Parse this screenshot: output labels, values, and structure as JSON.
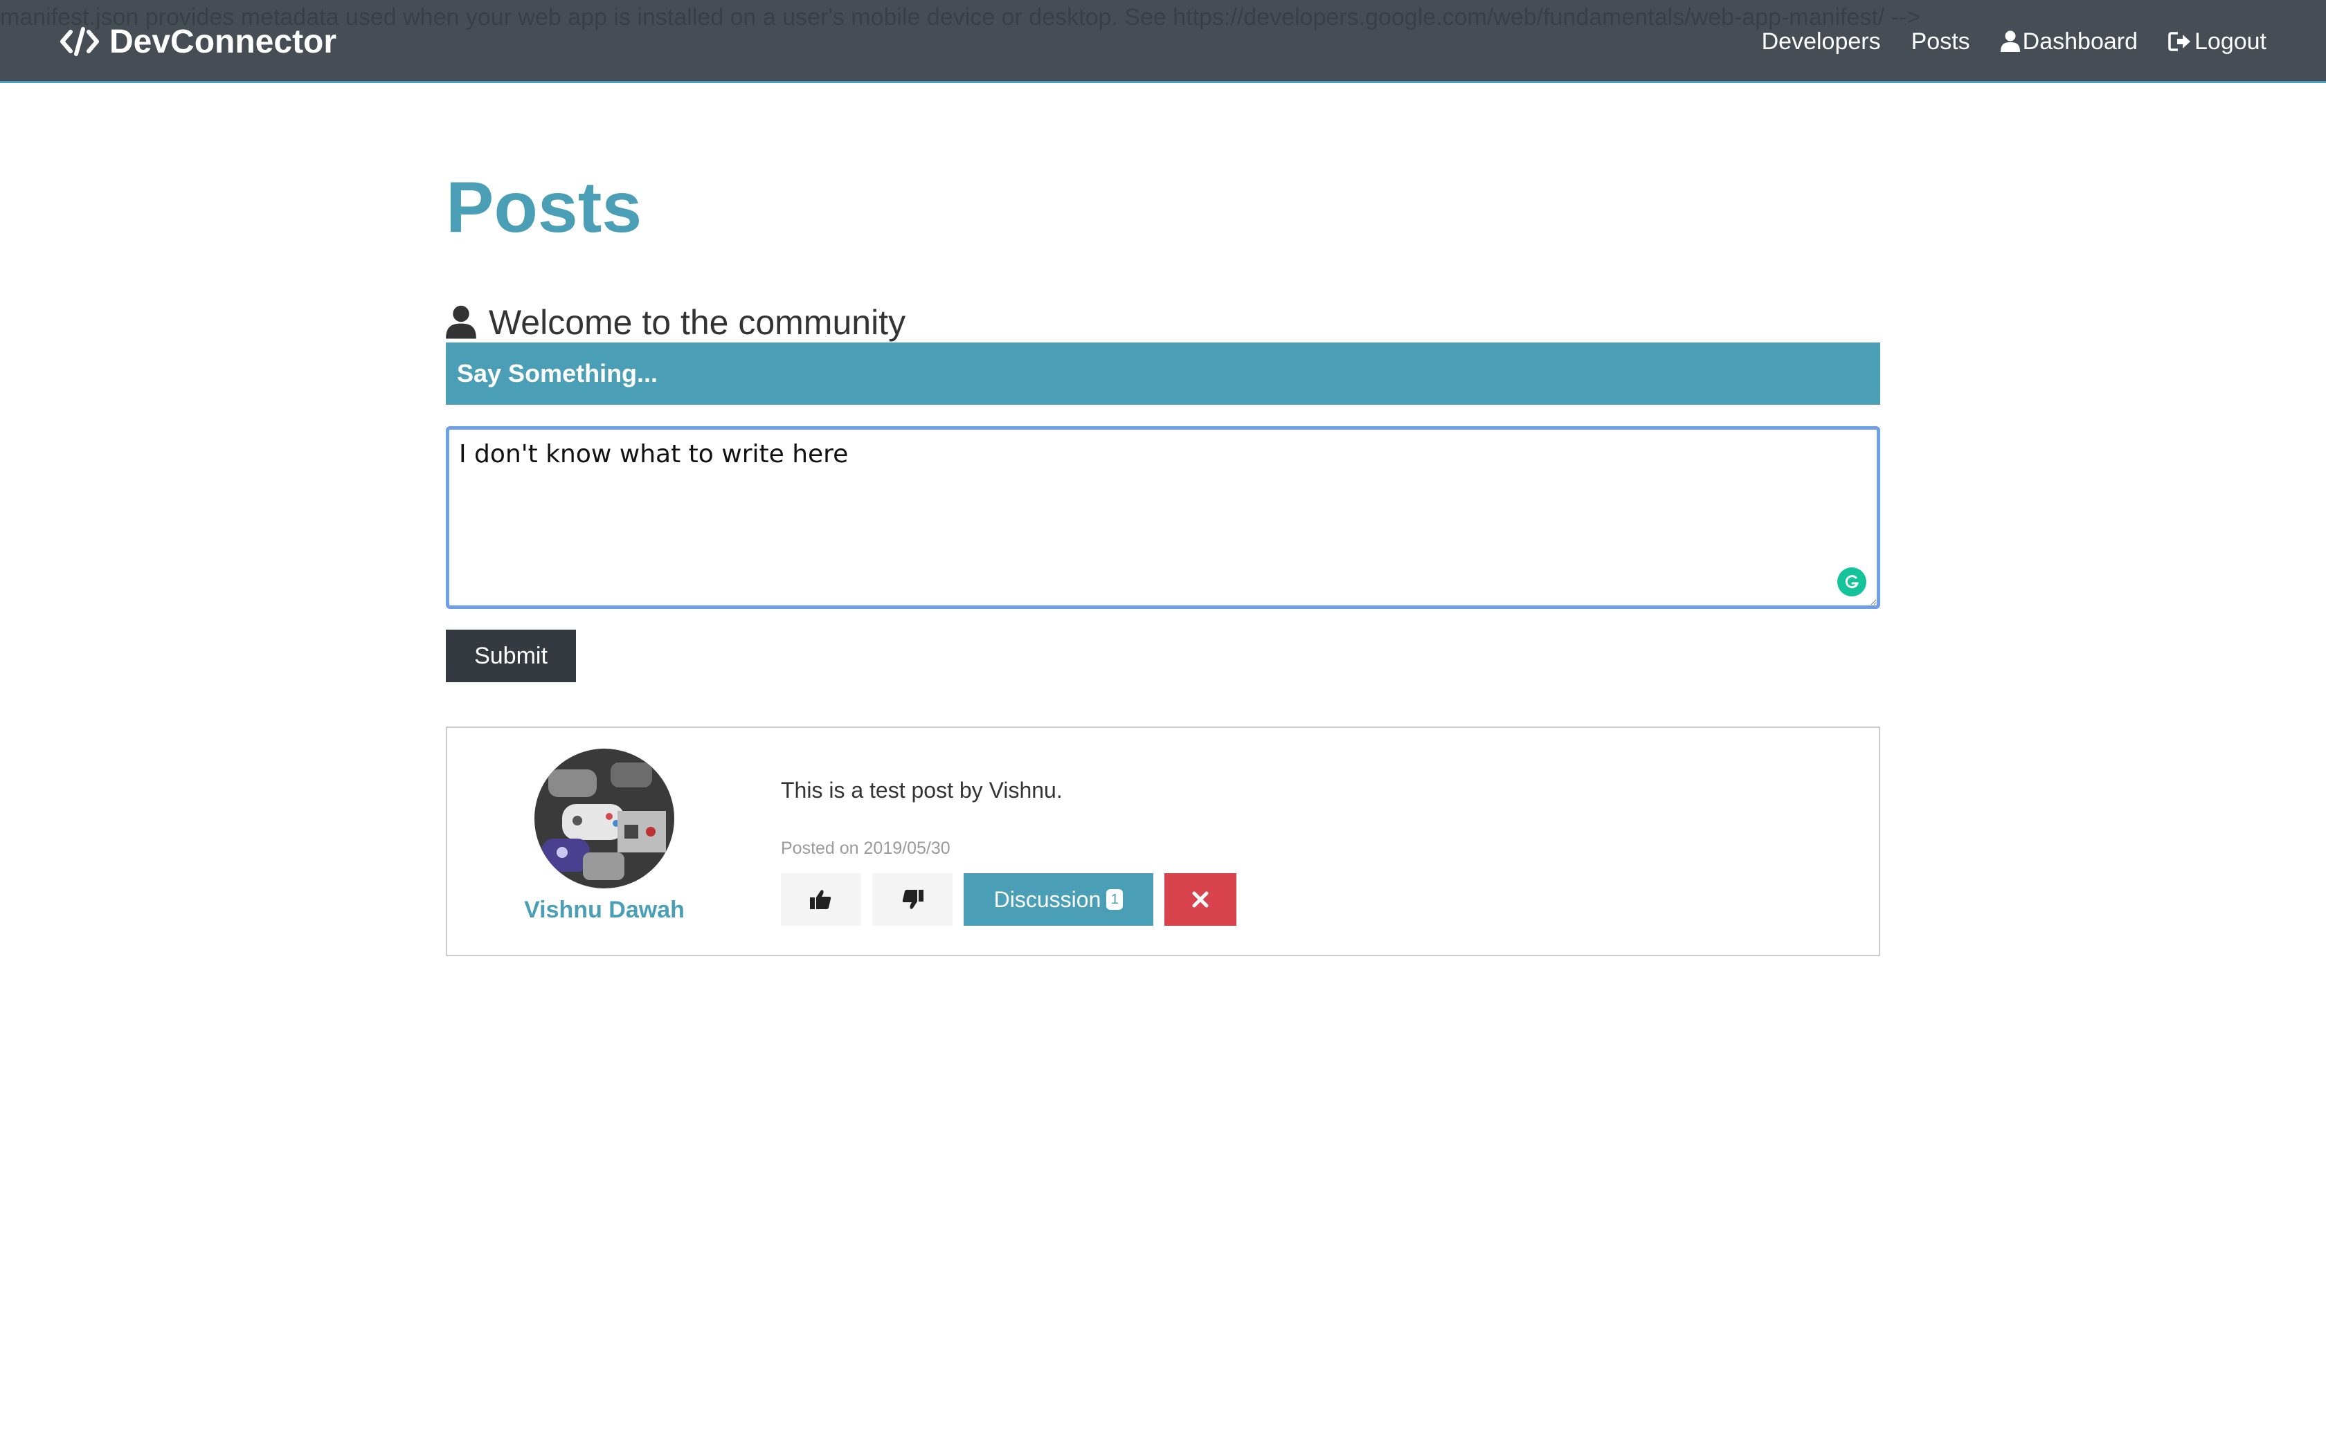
{
  "leaked_comment": "manifest.json provides metadata used when your web app is installed on a user's mobile device or desktop. See https://developers.google.com/web/fundamentals/web-app-manifest/ -->",
  "navbar": {
    "brand": "DevConnector",
    "links": {
      "developers": "Developers",
      "posts": "Posts",
      "dashboard": "Dashboard",
      "logout": "Logout"
    }
  },
  "page": {
    "title": "Posts",
    "lead": "Welcome to the community"
  },
  "form": {
    "header": "Say Something...",
    "textarea_value": "I don't know what to write here",
    "submit_label": "Submit"
  },
  "post": {
    "author": "Vishnu Dawah",
    "text": "This is a test post by Vishnu.",
    "date": "Posted on 2019/05/30",
    "discussion_label": "Discussion",
    "comment_count": "1"
  },
  "colors": {
    "navbar": "#474d55",
    "primary": "#4a9fb6",
    "dark": "#343a40",
    "danger": "#d9434e",
    "light": "#f4f4f4"
  },
  "icons": {
    "brand": "code-icon",
    "lead": "user-icon",
    "dashboard": "user-icon",
    "logout": "sign-out-icon",
    "like": "thumbs-up-icon",
    "dislike": "thumbs-down-icon",
    "delete": "times-icon",
    "grammarly": "grammarly-icon"
  }
}
